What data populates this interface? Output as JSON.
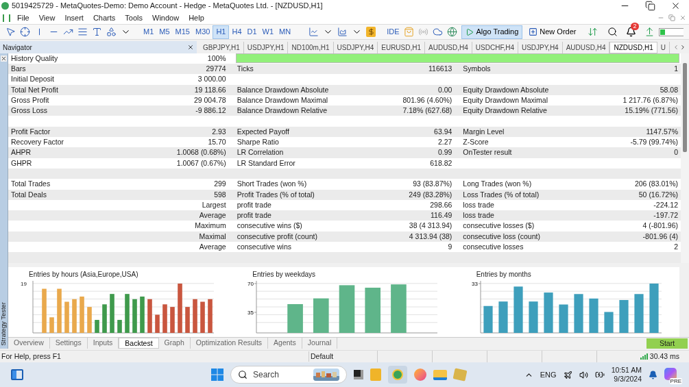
{
  "window": {
    "title": "5019425729 - MetaQuotes-Demo: Demo Account - Hedge - MetaQuotes Ltd. - [NZDUSD,H1]"
  },
  "menu": [
    "File",
    "View",
    "Insert",
    "Charts",
    "Tools",
    "Window",
    "Help"
  ],
  "toolbar": {
    "timeframes": [
      {
        "label": "M1",
        "selected": false
      },
      {
        "label": "M5",
        "selected": false
      },
      {
        "label": "M15",
        "selected": false
      },
      {
        "label": "M30",
        "selected": false
      },
      {
        "label": "H1",
        "selected": true
      },
      {
        "label": "H4",
        "selected": false
      },
      {
        "label": "D1",
        "selected": false
      },
      {
        "label": "W1",
        "selected": false
      },
      {
        "label": "MN",
        "selected": false
      }
    ],
    "ide": "IDE",
    "algo_trading": {
      "label": "Algo Trading",
      "on": true
    },
    "new_order": "New Order",
    "notifications": "2"
  },
  "navigator": {
    "title": "Navigator"
  },
  "chart_tabs": [
    {
      "label": "GBPJPY,H1",
      "selected": false
    },
    {
      "label": "USDJPY,H1",
      "selected": false
    },
    {
      "label": "ND100m,H1",
      "selected": false
    },
    {
      "label": "USDJPY,H4",
      "selected": false
    },
    {
      "label": "EURUSD,H1",
      "selected": false
    },
    {
      "label": "AUDUSD,H4",
      "selected": false
    },
    {
      "label": "USDCHF,H4",
      "selected": false
    },
    {
      "label": "USDJPY,H4",
      "selected": false
    },
    {
      "label": "AUDUSD,H4",
      "selected": false
    },
    {
      "label": "NZDUSD,H1",
      "selected": true
    },
    {
      "label": "U",
      "selected": false
    }
  ],
  "report": {
    "history_quality": {
      "label": "History Quality",
      "value": "100%",
      "level": 1
    },
    "rows": [
      {
        "cells": [
          "Bars",
          "29774",
          "Ticks",
          "116613",
          "Symbols",
          "1"
        ]
      },
      {
        "cells": [
          "Initial Deposit",
          "3 000.00",
          null,
          null,
          null,
          null
        ]
      },
      {
        "cells": [
          "Total Net Profit",
          "19 118.66",
          "Balance Drawdown Absolute",
          "0.00",
          "Equity Drawdown Absolute",
          "58.08"
        ]
      },
      {
        "cells": [
          "Gross Profit",
          "29 004.78",
          "Balance Drawdown Maximal",
          "801.96 (4.60%)",
          "Equity Drawdown Maximal",
          "1 217.76 (6.87%)"
        ]
      },
      {
        "cells": [
          "Gross Loss",
          "-9 886.12",
          "Balance Drawdown Relative",
          "7.18% (627.68)",
          "Equity Drawdown Relative",
          "15.19% (771.56)"
        ]
      },
      {
        "cells": [
          null,
          null,
          null,
          null,
          null,
          null
        ]
      },
      {
        "cells": [
          "Profit Factor",
          "2.93",
          "Expected Payoff",
          "63.94",
          "Margin Level",
          "1147.57%"
        ]
      },
      {
        "cells": [
          "Recovery Factor",
          "15.70",
          "Sharpe Ratio",
          "2.27",
          "Z-Score",
          "-5.79 (99.74%)"
        ]
      },
      {
        "cells": [
          "AHPR",
          "1.0068 (0.68%)",
          "LR Correlation",
          "0.99",
          "OnTester result",
          "0"
        ]
      },
      {
        "cells": [
          "GHPR",
          "1.0067 (0.67%)",
          "LR Standard Error",
          "618.82",
          null,
          null
        ]
      },
      {
        "cells": [
          null,
          null,
          null,
          null,
          null,
          null
        ]
      },
      {
        "cells": [
          "Total Trades",
          "299",
          "Short Trades (won %)",
          "93 (83.87%)",
          "Long Trades (won %)",
          "206 (83.01%)"
        ]
      },
      {
        "cells": [
          "Total Deals",
          "598",
          "Profit Trades (% of total)",
          "249 (83.28%)",
          "Loss Trades (% of total)",
          "50 (16.72%)"
        ]
      },
      {
        "cells": [
          null,
          "Largest",
          "profit trade",
          "298.66",
          "loss trade",
          "-224.12"
        ]
      },
      {
        "cells": [
          null,
          "Average",
          "profit trade",
          "116.49",
          "loss trade",
          "-197.72"
        ]
      },
      {
        "cells": [
          null,
          "Maximum",
          "consecutive wins ($)",
          "38 (4 313.94)",
          "consecutive losses ($)",
          "4 (-801.96)"
        ]
      },
      {
        "cells": [
          null,
          "Maximal",
          "consecutive profit (count)",
          "4 313.94 (38)",
          "consecutive loss (count)",
          "-801.96 (4)"
        ]
      },
      {
        "cells": [
          null,
          "Average",
          "consecutive wins",
          "9",
          "consecutive losses",
          "2"
        ]
      },
      {
        "cells": [
          null,
          null,
          null,
          null,
          null,
          null
        ]
      }
    ]
  },
  "charts": [
    {
      "kind": "picture",
      "title": "Entries by hours (Asia,Europe,USA)",
      "top_label": "19"
    },
    {
      "chart_data": {
        "type": "bar",
        "title": "Entries by weekdays",
        "ylim": [
          10,
          70
        ],
        "yticks": [
          35,
          70
        ],
        "series": [
          {
            "color": "#5fb58a",
            "values": [
              null,
              45,
              52,
              68,
              65,
              69,
              null
            ]
          }
        ]
      }
    },
    {
      "chart_data": {
        "type": "bar",
        "title": "Entries by months",
        "ylim": [
          0,
          33
        ],
        "yticks": [
          33
        ],
        "series": [
          {
            "color": "#3e9fbc",
            "values": [
              18,
              21,
              31,
              21,
              27,
              19,
              26,
              23,
              14,
              22,
              26,
              33
            ]
          }
        ]
      }
    }
  ],
  "side_panel": {
    "title": "Strategy Tester"
  },
  "bottom_tabs": [
    {
      "label": "Overview",
      "selected": false
    },
    {
      "label": "Settings",
      "selected": false
    },
    {
      "label": "Inputs",
      "selected": false
    },
    {
      "label": "Backtest",
      "selected": true
    },
    {
      "label": "Graph",
      "selected": false
    },
    {
      "label": "Optimization Results",
      "selected": false
    },
    {
      "label": "Agents",
      "selected": false
    },
    {
      "label": "Journal",
      "selected": false
    }
  ],
  "start_button": "Start",
  "status_bar": {
    "help": "For Help, press F1",
    "profile": "Default",
    "ping": "30.43 ms"
  },
  "taskbar": {
    "search": {
      "placeholder": "Search"
    },
    "language": "ENG",
    "time": "10:51 AM",
    "date": "9/3/2024",
    "copilot_badge": "PRE"
  }
}
